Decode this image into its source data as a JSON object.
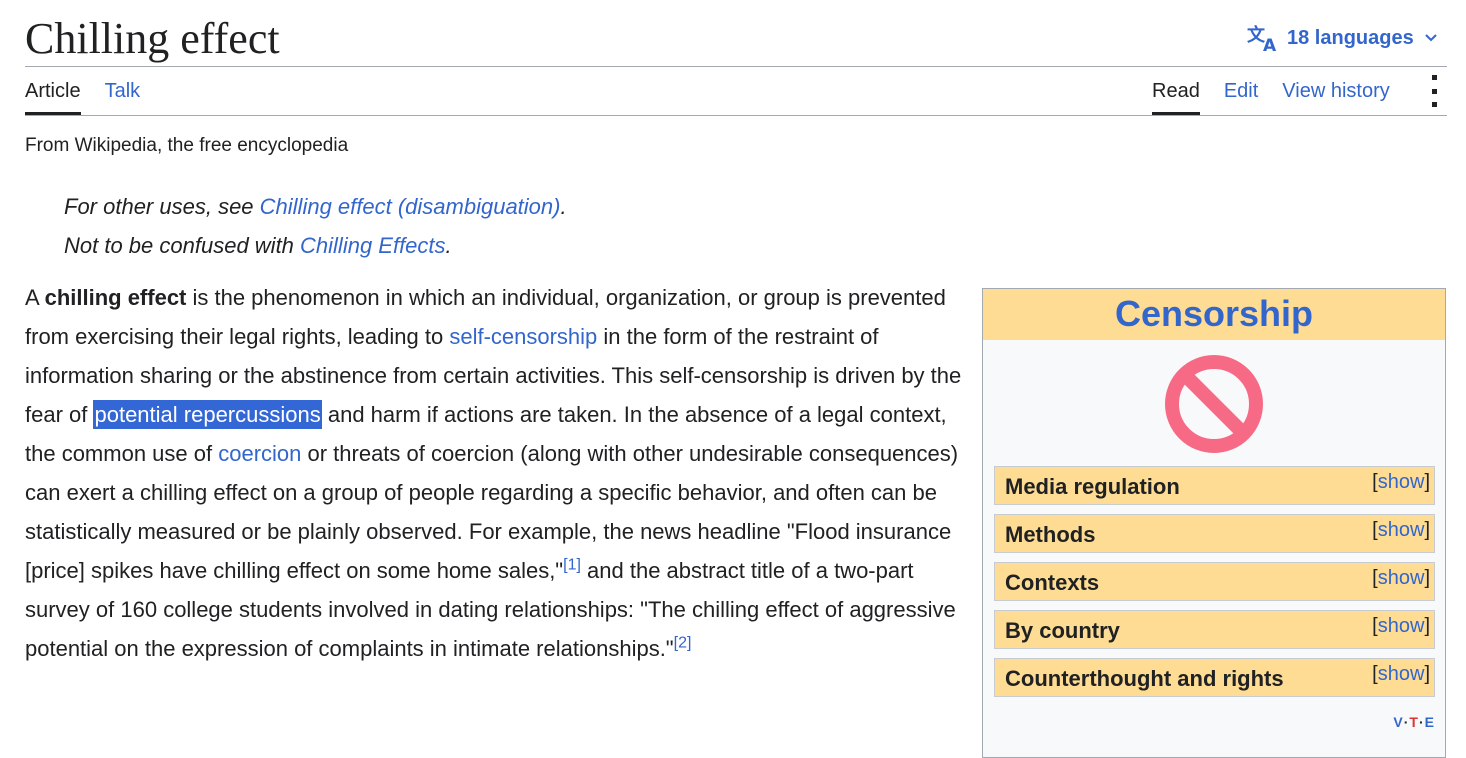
{
  "header": {
    "title": "Chilling effect",
    "languages_label": "18 languages"
  },
  "tabs": {
    "left": [
      "Article",
      "Talk"
    ],
    "right": [
      "Read",
      "Edit",
      "View history"
    ]
  },
  "tagline": "From Wikipedia, the free encyclopedia",
  "hatnotes": {
    "line1_prefix": "For other uses, see ",
    "line1_link": "Chilling effect (disambiguation)",
    "line1_suffix": ".",
    "line2_prefix": "Not to be confused with ",
    "line2_link": "Chilling Effects",
    "line2_suffix": "."
  },
  "paragraph": {
    "t0": "A ",
    "bold": "chilling effect",
    "t1": " is the phenomenon in which an individual, organization, or group is prevented from exercising their legal rights, leading to ",
    "link1": "self-censorship",
    "t2": " in the form of the restraint of information sharing or the abstinence from certain activities. This self-censorship is driven by the fear of ",
    "selected": "potential repercussions",
    "t3": " and harm if actions are taken. In the absence of a legal context, the common use of ",
    "link2": "coercion",
    "t4": " or threats of coercion (along with other undesirable consequences) can exert a chilling effect on a group of people regarding a specific behavior, and often can be statistically measured or be plainly observed. For example, the news headline \"Flood insurance [price] spikes have chilling effect on some home sales,\"",
    "ref1": "[1]",
    "t5": " and the abstract title of a two-part survey of 160 college students involved in dating relationships: \"The chilling effect of aggressive potential on the expression of complaints in intimate relationships.\"",
    "ref2": "[2]"
  },
  "navbox": {
    "title": "Censorship",
    "icon": "prohibition-sign-icon",
    "icon_color": "#f66a86",
    "header_bg": "#fedc94",
    "rows": [
      {
        "label": "Media regulation",
        "toggle": "show"
      },
      {
        "label": "Methods",
        "toggle": "show"
      },
      {
        "label": "Contexts",
        "toggle": "show"
      },
      {
        "label": "By country",
        "toggle": "show"
      },
      {
        "label": "Counterthought and rights",
        "toggle": "show"
      }
    ],
    "vte": {
      "v": "V",
      "t": "T",
      "e": "E",
      "sep": "·"
    }
  },
  "colors": {
    "link": "#3366cc",
    "text": "#202122",
    "selection": "#3367d6"
  }
}
